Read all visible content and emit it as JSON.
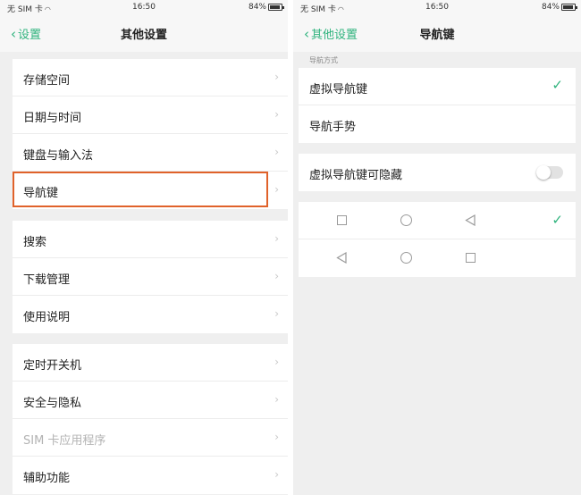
{
  "left": {
    "status": {
      "carrier": "无 SIM 卡",
      "time": "16:50",
      "battery": "84%"
    },
    "nav": {
      "back_label": "设置",
      "title": "其他设置"
    },
    "groups": [
      {
        "items": [
          {
            "label": "存储空间"
          },
          {
            "label": "日期与时间"
          },
          {
            "label": "键盘与输入法"
          },
          {
            "label": "导航键"
          }
        ]
      },
      {
        "items": [
          {
            "label": "搜索"
          },
          {
            "label": "下载管理"
          },
          {
            "label": "使用说明"
          }
        ]
      },
      {
        "items": [
          {
            "label": "定时开关机"
          },
          {
            "label": "安全与隐私"
          },
          {
            "label": "SIM 卡应用程序"
          },
          {
            "label": "辅助功能"
          }
        ]
      }
    ]
  },
  "right": {
    "status": {
      "carrier": "无 SIM 卡",
      "time": "16:50",
      "battery": "84%"
    },
    "nav": {
      "back_label": "其他设置",
      "title": "导航键"
    },
    "section_caption": "导航方式",
    "nav_modes": [
      {
        "label": "虚拟导航键",
        "selected": true
      },
      {
        "label": "导航手势",
        "selected": false
      }
    ],
    "hide_toggle": {
      "label": "虚拟导航键可隐藏",
      "on": false
    },
    "key_layouts": [
      {
        "order": [
          "square-icon",
          "circle-icon",
          "triangle-left-icon"
        ],
        "selected": true
      },
      {
        "order": [
          "triangle-left-icon",
          "circle-icon",
          "square-icon"
        ],
        "selected": false
      }
    ]
  },
  "colors": {
    "accent": "#2fb37d",
    "highlight": "#e0622a",
    "background": "#efefef"
  }
}
